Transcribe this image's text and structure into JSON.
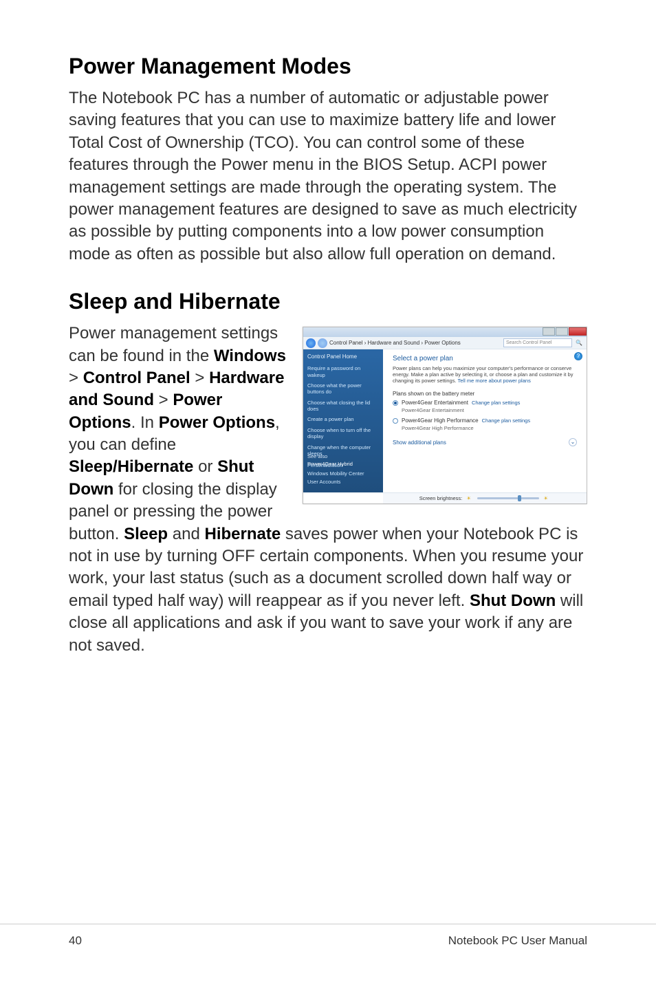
{
  "section1": {
    "title": "Power Management Modes",
    "body": "The Notebook PC has a number of automatic or adjustable power saving features that you can use to maximize battery life and lower Total Cost of Ownership (TCO). You can control some of these features through the Power menu in the BIOS Setup. ACPI power management settings are made through the operating system. The power management features are designed to save as much electricity as possible by putting components into a low power consumption mode as often as possible but also allow full operation on demand."
  },
  "section2": {
    "title": "Sleep and Hibernate",
    "p_a": "Power management settings can be found in the ",
    "bold_windows": "Windows",
    "gt1": " > ",
    "bold_cp": "Control Panel",
    "gt2": " > ",
    "bold_hs": "Hardware and Sound",
    "gt3": " > ",
    "bold_po": "Power Options",
    "p_b": ". In ",
    "bold_po2": "Power Options",
    "p_c": ", you can define ",
    "bold_sh": "Sleep/Hibernate",
    "p_d": " or ",
    "bold_sd": "Shut Down",
    "p_e": " for closing the display panel or pressing the power button. ",
    "bold_sleep": "Sleep",
    "p_f": " and ",
    "bold_hib": "Hibernate",
    "p_g": " saves power when your Notebook PC is not in use by turning OFF certain components. When you resume your work, your last status (such as a document scrolled down half way or email typed half way) will reappear as if you never left. ",
    "bold_sd2": "Shut Down",
    "p_h": " will close all applications and ask if you want to save your work if any are not saved."
  },
  "screenshot": {
    "breadcrumb": "Control Panel › Hardware and Sound › Power Options",
    "search_placeholder": "Search Control Panel",
    "sidebar_home": "Control Panel Home",
    "links": [
      "Require a password on wakeup",
      "Choose what the power buttons do",
      "Choose what closing the lid does",
      "Create a power plan",
      "Choose when to turn off the display",
      "Change when the computer sleeps",
      "Power4Gear Hybrid"
    ],
    "see_also": "See also",
    "bottom_links": [
      "Personalization",
      "Windows Mobility Center",
      "User Accounts"
    ],
    "heading": "Select a power plan",
    "desc1": "Power plans can help you maximize your computer's performance or conserve energy. Make a plan active by selecting it, or choose a plan and customize it by changing its power settings. ",
    "desc_link": "Tell me more about power plans",
    "fieldset": "Plans shown on the battery meter",
    "plan1_name": "Power4Gear Entertainment",
    "plan1_sub": "Power4Gear Entertainment",
    "plan2_name": "Power4Gear High Performance",
    "plan2_sub": "Power4Gear High Performance",
    "change": "Change plan settings",
    "show_add": "Show additional plans",
    "brightness": "Screen brightness:"
  },
  "footer": {
    "page": "40",
    "title": "Notebook PC User Manual"
  }
}
